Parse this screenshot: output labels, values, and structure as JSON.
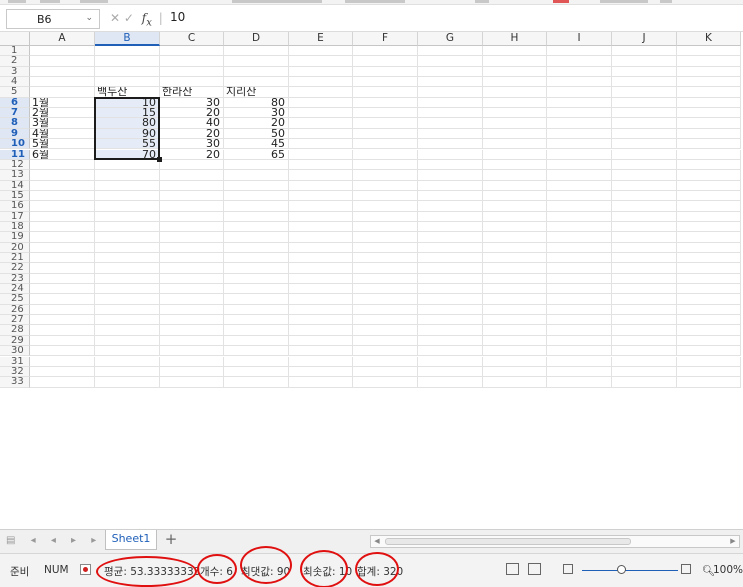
{
  "formula_bar": {
    "cell_ref": "B6",
    "value": "10",
    "icons": [
      "cancel-icon",
      "confirm-icon",
      "function-icon"
    ]
  },
  "columns": [
    "A",
    "B",
    "C",
    "D",
    "E",
    "F",
    "G",
    "H",
    "I",
    "J",
    "K"
  ],
  "row_count": 33,
  "selected_column": "B",
  "selected_rows": [
    6,
    7,
    8,
    9,
    10,
    11
  ],
  "cells": {
    "B5": "백두산",
    "C5": "한라산",
    "D5": "지리산",
    "A6": "1월",
    "B6": "10",
    "C6": "30",
    "D6": "80",
    "A7": "2월",
    "B7": "15",
    "C7": "20",
    "D7": "30",
    "A8": "3월",
    "B8": "80",
    "C8": "40",
    "D8": "20",
    "A9": "4월",
    "B9": "90",
    "C9": "20",
    "D9": "50",
    "A10": "5월",
    "B10": "55",
    "C10": "30",
    "D10": "45",
    "A11": "6월",
    "B11": "70",
    "C11": "20",
    "D11": "65"
  },
  "sheet_tabs": {
    "active": "Sheet1",
    "add_label": "+"
  },
  "status_bar": {
    "mode": "준비",
    "num": "NUM",
    "average": "평균: 53.33333333",
    "count": "개수: 6",
    "max": "최댓값: 90",
    "min": "최솟값: 10",
    "sum": "합계: 320",
    "zoom": "100%"
  },
  "colors": {
    "selection_fill": "#e6ecf7",
    "header_selected": "#dfe7f5",
    "accent": "#1f5fb8",
    "annotation": "#e01010"
  }
}
